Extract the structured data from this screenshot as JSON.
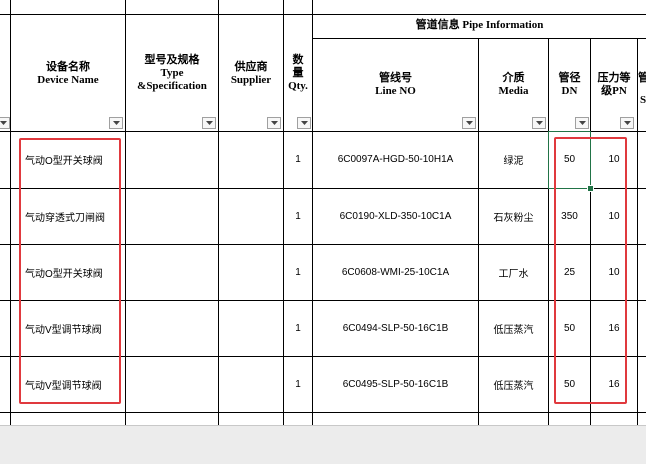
{
  "headers": {
    "pipe_info": "管道信息 Pipe Information",
    "device_cn": "设备名称",
    "device_en": "Device Name",
    "type_cn": "型号及规格",
    "type_en1": "Type",
    "type_en2": "&Specification",
    "supplier_cn": "供应商",
    "supplier_en": "Supplier",
    "qty_cn1": "数",
    "qty_cn2": "量",
    "qty_en": "Qty.",
    "line_cn": "管线号",
    "line_en": "Line NO",
    "media_cn": "介质",
    "media_en": "Media",
    "dn_cn": "管径",
    "dn_en": "DN",
    "pn_cn1": "压力等",
    "pn_cn2": "级PN",
    "cut_top": "管",
    "cut_bottom": "S"
  },
  "rows": [
    {
      "device": "气动O型开关球阀",
      "qty": "1",
      "line": "6C0097A-HGD-50-10H1A",
      "media": "绿泥",
      "dn": "50",
      "pn": "10"
    },
    {
      "device": "气动穿透式刀闸阀",
      "qty": "1",
      "line": "6C0190-XLD-350-10C1A",
      "media": "石灰粉尘",
      "dn": "350",
      "pn": "10"
    },
    {
      "device": "气动O型开关球阀",
      "qty": "1",
      "line": "6C0608-WMI-25-10C1A",
      "media": "工厂水",
      "dn": "25",
      "pn": "10"
    },
    {
      "device": "气动V型调节球阀",
      "qty": "1",
      "line": "6C0494-SLP-50-16C1B",
      "media": "低压蒸汽",
      "dn": "50",
      "pn": "16"
    },
    {
      "device": "气动V型调节球阀",
      "qty": "1",
      "line": "6C0495-SLP-50-16C1B",
      "media": "低压蒸汽",
      "dn": "50",
      "pn": "16"
    }
  ],
  "colors": {
    "highlight": "#e0393e",
    "selection": "#217346"
  },
  "icons": [
    "filter-dropdown-icon"
  ]
}
